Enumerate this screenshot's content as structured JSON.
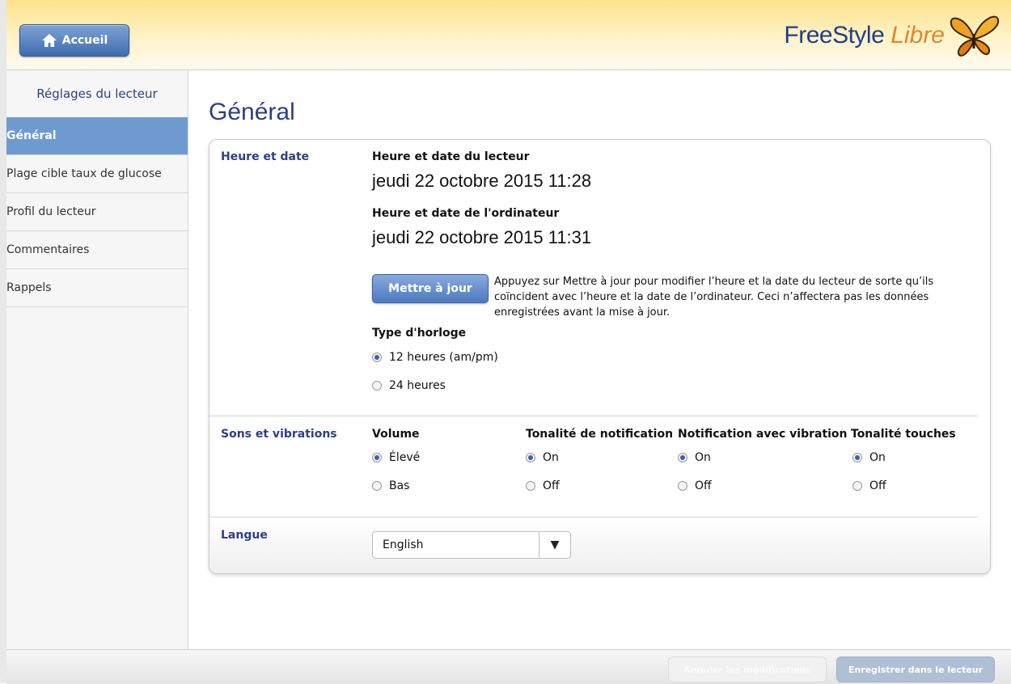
{
  "header": {
    "home_label": "Accueil",
    "logo_freestyle": "FreeStyle",
    "logo_libre": "Libre"
  },
  "sidebar": {
    "title": "Réglages du lecteur",
    "items": [
      {
        "label": "Général",
        "active": true
      },
      {
        "label": "Plage cible taux de glucose",
        "active": false
      },
      {
        "label": "Profil du lecteur",
        "active": false
      },
      {
        "label": "Commentaires",
        "active": false
      },
      {
        "label": "Rappels",
        "active": false
      }
    ]
  },
  "main": {
    "title": "Général",
    "time_date": {
      "section_label": "Heure et date",
      "reader_label": "Heure et date du lecteur",
      "reader_value": "jeudi 22 octobre 2015 11:28",
      "computer_label": "Heure et date de l'ordinateur",
      "computer_value": "jeudi 22 octobre 2015 11:31",
      "update_button": "Mettre à jour",
      "update_text": "Appuyez sur Mettre à jour pour modifier l’heure et la date du lecteur de sorte qu’ils coïncident avec l’heure et la date de l’ordinateur. Ceci n’affectera pas les données enregistrées avant la mise à jour.",
      "clock_type_label": "Type d'horloge",
      "clock_options": [
        {
          "label": "12 heures (am/pm)",
          "selected": true
        },
        {
          "label": "24 heures",
          "selected": false
        }
      ]
    },
    "sounds": {
      "section_label": "Sons et vibrations",
      "volume": {
        "label": "Volume",
        "options": [
          {
            "label": "Élevé",
            "selected": true
          },
          {
            "label": "Bas",
            "selected": false
          }
        ]
      },
      "notification_tone": {
        "label": "Tonalité de notification",
        "options": [
          {
            "label": "On",
            "selected": true
          },
          {
            "label": "Off",
            "selected": false
          }
        ]
      },
      "vibration": {
        "label": "Notification avec vibration",
        "options": [
          {
            "label": "On",
            "selected": true
          },
          {
            "label": "Off",
            "selected": false
          }
        ]
      },
      "key_tone": {
        "label": "Tonalité touches",
        "options": [
          {
            "label": "On",
            "selected": true
          },
          {
            "label": "Off",
            "selected": false
          }
        ]
      }
    },
    "language": {
      "section_label": "Langue",
      "selected": "English"
    }
  },
  "footer": {
    "cancel_label": "Annuler les modifications",
    "save_label": "Enregistrer dans le lecteur"
  },
  "colors": {
    "brand_blue": "#2c3f86",
    "button_blue": "#4c79bf",
    "active_nav": "#6f9ad0",
    "logo_orange": "#e3862a"
  }
}
